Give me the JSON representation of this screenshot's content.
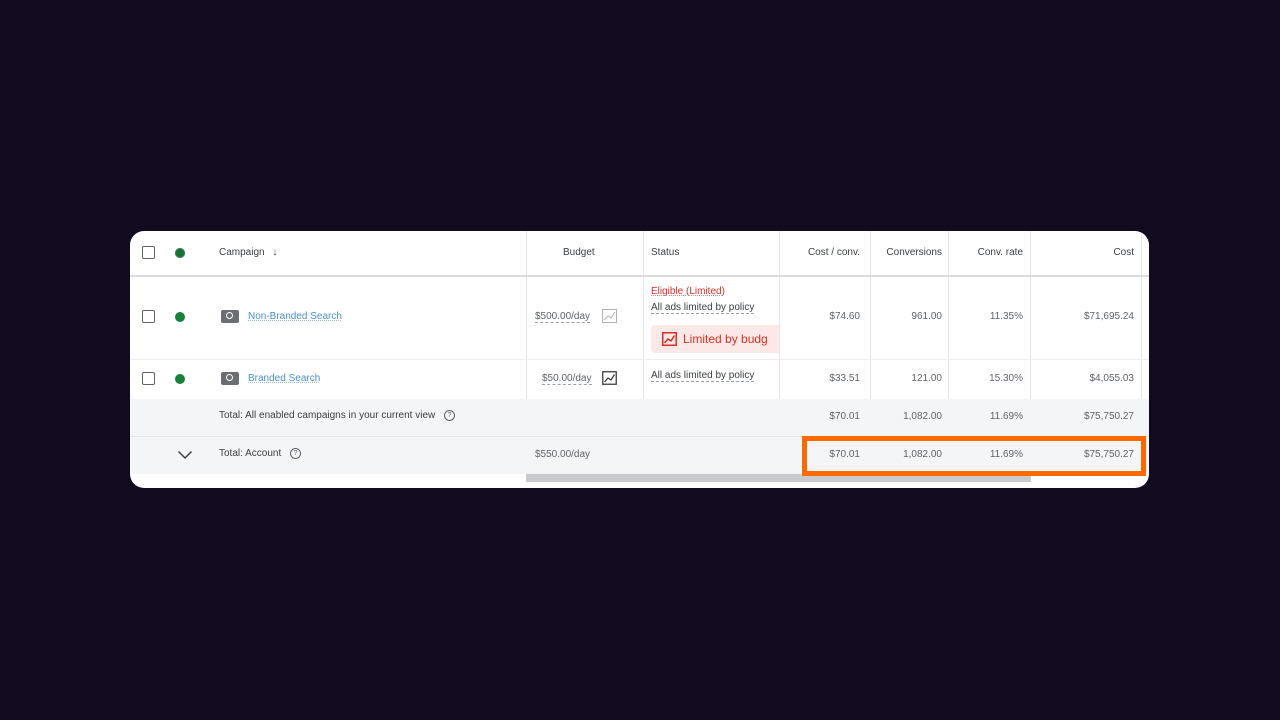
{
  "header": {
    "campaign": "Campaign",
    "sort_glyph": "↓",
    "budget": "Budget",
    "status": "Status",
    "cost_conv": "Cost / conv.",
    "conversions": "Conversions",
    "conv_rate": "Conv. rate",
    "cost": "Cost"
  },
  "rows": [
    {
      "campaign": "Non-Branded Search",
      "budget": "$500.00/day",
      "status_eligible": "Eligible (Limited)",
      "status_detail": "All ads limited by policy",
      "status_chip": "Limited by budg",
      "cost_conv": "$74.60",
      "conversions": "961.00",
      "conv_rate": "11.35%",
      "cost": "$71,695.24"
    },
    {
      "campaign": "Branded Search",
      "budget": "$50.00/day",
      "status_detail": "All ads limited by policy",
      "cost_conv": "$33.51",
      "conversions": "121.00",
      "conv_rate": "15.30%",
      "cost": "$4,055.03"
    }
  ],
  "totals": {
    "enabled": {
      "label": "Total: All enabled campaigns in your current view",
      "cost_conv": "$70.01",
      "conversions": "1,082.00",
      "conv_rate": "11.69%",
      "cost": "$75,750.27"
    },
    "account": {
      "label": "Total: Account",
      "budget": "$550.00/day",
      "cost_conv": "$70.01",
      "conversions": "1,082.00",
      "conv_rate": "11.69%",
      "cost": "$75,750.27"
    }
  },
  "icons": {
    "help": "?",
    "chevron": "chevron-down-icon"
  },
  "colors": {
    "background": "#120a1f",
    "highlight": "#ff6a00",
    "enabled_dot": "#188038",
    "error_red": "#d93025",
    "link_blue": "#4a8fd6"
  }
}
